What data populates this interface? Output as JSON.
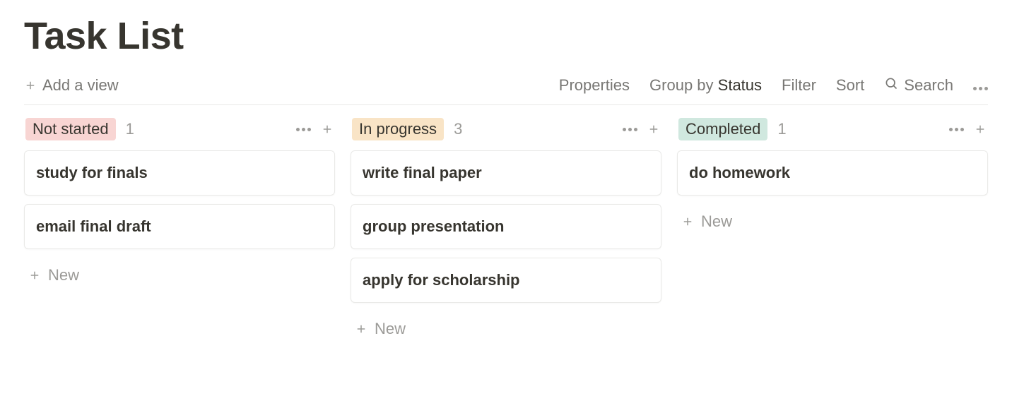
{
  "page": {
    "title": "Task List"
  },
  "toolbar": {
    "add_view": "Add a view",
    "properties": "Properties",
    "group_by_prefix": "Group by ",
    "group_by_value": "Status",
    "filter": "Filter",
    "sort": "Sort",
    "search": "Search"
  },
  "columns": [
    {
      "name": "Not started",
      "count": "1",
      "color": "pink",
      "cards": [
        {
          "title": "study for finals"
        },
        {
          "title": "email final draft"
        }
      ],
      "new_label": "New"
    },
    {
      "name": "In progress",
      "count": "3",
      "color": "orange",
      "cards": [
        {
          "title": "write final paper"
        },
        {
          "title": "group presentation"
        },
        {
          "title": "apply for scholarship"
        }
      ],
      "new_label": "New"
    },
    {
      "name": "Completed",
      "count": "1",
      "color": "green",
      "cards": [
        {
          "title": "do homework"
        }
      ],
      "new_label": "New"
    }
  ]
}
